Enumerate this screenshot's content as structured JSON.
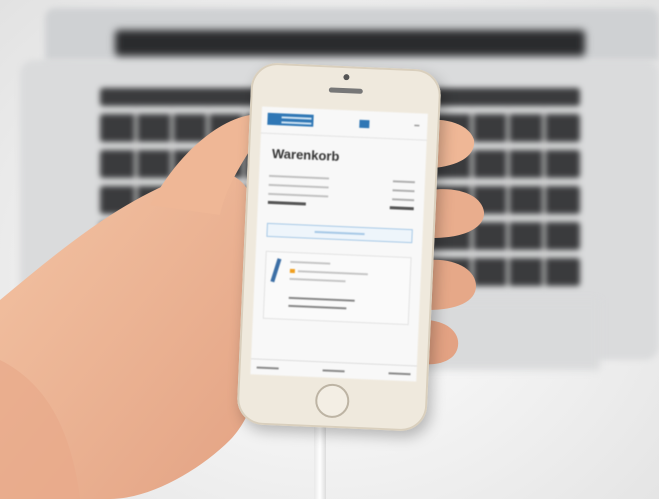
{
  "scene": "photo",
  "screen": {
    "title": "Warenkorb",
    "colors": {
      "brand": "#2f77b5",
      "accent": "#f0a020"
    }
  }
}
